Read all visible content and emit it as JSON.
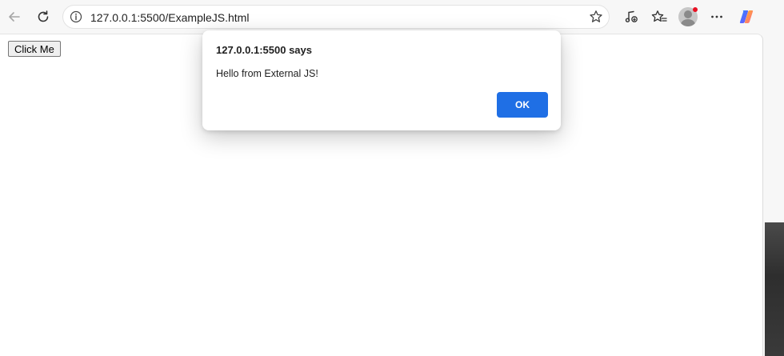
{
  "browser": {
    "url": "127.0.0.1:5500/ExampleJS.html",
    "icons": {
      "back": "back-arrow-icon",
      "reload": "reload-icon",
      "site_info": "info-icon",
      "favorite": "star-icon",
      "media": "music-note-icon",
      "favorites": "favorites-icon",
      "profile": "profile-avatar",
      "more": "more-dots-icon",
      "copilot": "copilot-icon"
    }
  },
  "page": {
    "button_label": "Click Me"
  },
  "dialog": {
    "title": "127.0.0.1:5500 says",
    "message": "Hello from External JS!",
    "ok_label": "OK"
  },
  "colors": {
    "accent": "#1f6fe5",
    "notification_dot": "#e81123"
  }
}
